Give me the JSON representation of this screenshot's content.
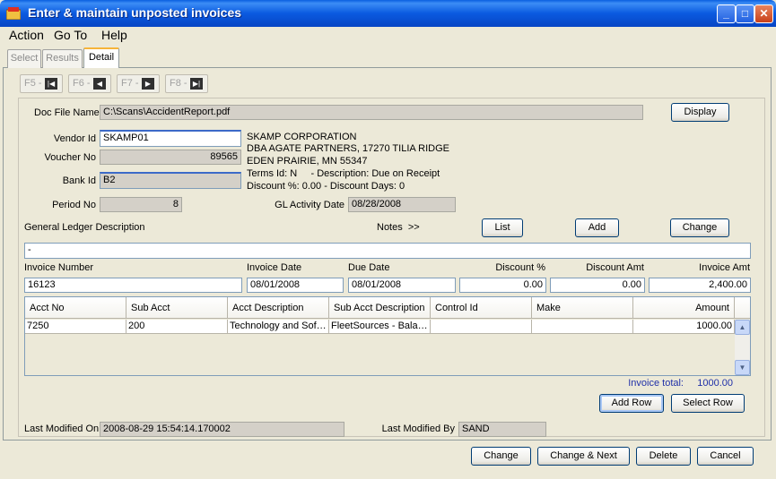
{
  "window": {
    "title": "Enter & maintain unposted invoices"
  },
  "menu": {
    "action": "Action",
    "goto": "Go To",
    "help": "Help"
  },
  "tabs": {
    "select": "Select",
    "results": "Results",
    "detail": "Detail"
  },
  "nav": {
    "first": "F5 -",
    "prev": "F6 -",
    "next": "F7 -",
    "last": "F8 -"
  },
  "doc": {
    "label": "Doc File Name",
    "value": "C:\\Scans\\AccidentReport.pdf",
    "display_button": "Display"
  },
  "vendor": {
    "vendor_id_label": "Vendor Id",
    "vendor_id": "SKAMP01",
    "voucher_label": "Voucher No",
    "voucher": "89565",
    "bank_label": "Bank Id",
    "bank": "B2",
    "period_label": "Period No",
    "period": "8",
    "name": "SKAMP CORPORATION",
    "dba": "DBA AGATE PARTNERS, 17270 TILIA RIDGE",
    "city": "EDEN PRAIRIE, MN 55347",
    "terms": "Terms Id: N     - Description: Due on Receipt",
    "discount": "Discount %: 0.00 - Discount Days: 0",
    "gl_date_label": "GL Activity Date",
    "gl_date": "08/28/2008"
  },
  "gl": {
    "desc_label": "General Ledger Description",
    "desc_value": "-",
    "notes_label": "Notes  >>",
    "list_button": "List",
    "add_button": "Add",
    "change_button": "Change"
  },
  "invoice": {
    "number_label": "Invoice Number",
    "number": "16123",
    "date_label": "Invoice Date",
    "date": "08/01/2008",
    "due_label": "Due Date",
    "due": "08/01/2008",
    "discount_pct_label": "Discount %",
    "discount_pct": "0.00",
    "discount_amt_label": "Discount Amt",
    "discount_amt": "0.00",
    "amount_label": "Invoice Amt",
    "amount": "2,400.00"
  },
  "grid": {
    "headers": [
      "Acct No",
      "Sub Acct",
      "Acct Description",
      "Sub Acct Description",
      "Control Id",
      "Make",
      "Amount"
    ],
    "rows": [
      [
        "7250",
        "200",
        "Technology and Soft...",
        "FleetSources - Balan...",
        "",
        "",
        "1000.00"
      ]
    ]
  },
  "totals": {
    "label": "Invoice total:",
    "value": "1000.00",
    "add_row": "Add Row",
    "select_row": "Select Row"
  },
  "modified": {
    "on_label": "Last Modified On",
    "on": "2008-08-29 15:54:14.170002",
    "by_label": "Last Modified By",
    "by": "SAND"
  },
  "footer": {
    "change": "Change",
    "change_next": "Change & Next",
    "delete": "Delete",
    "cancel": "Cancel"
  }
}
